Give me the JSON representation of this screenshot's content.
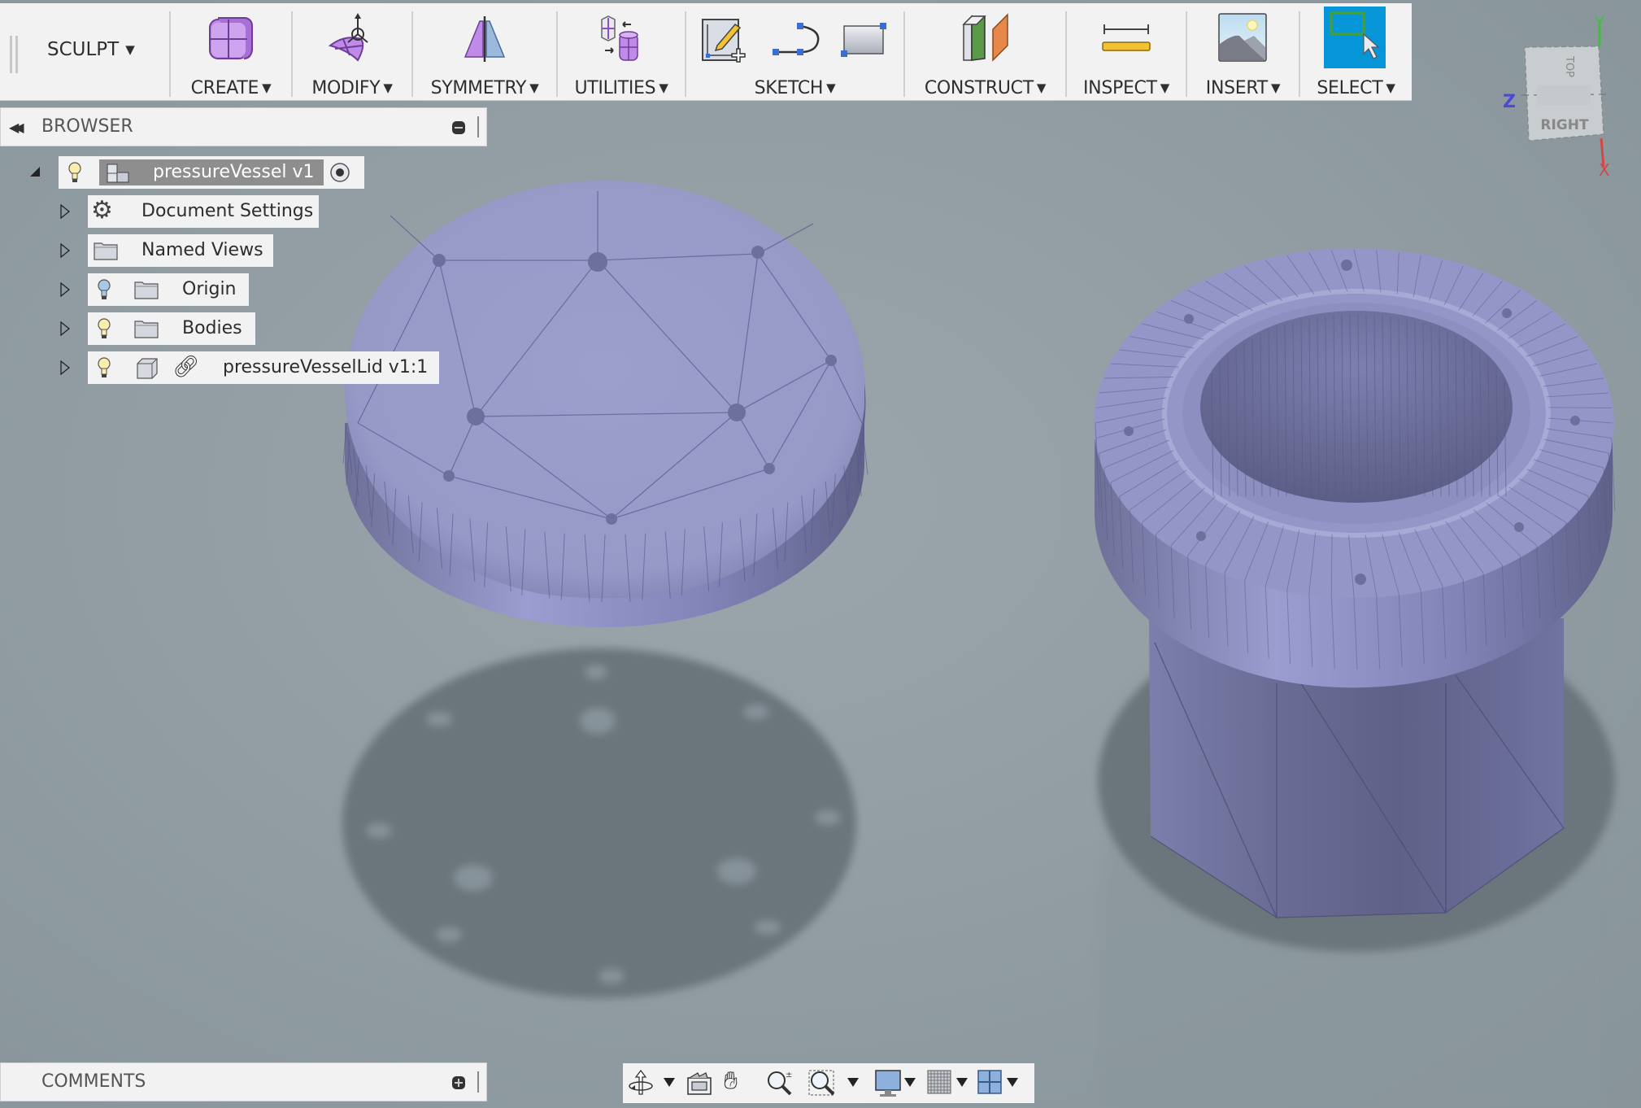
{
  "toolbar": {
    "workspace": "SCULPT",
    "groups": [
      {
        "id": "create",
        "label": "CREATE",
        "icon": "create-box-icon"
      },
      {
        "id": "modify",
        "label": "MODIFY",
        "icon": "modify-surface-icon"
      },
      {
        "id": "symmetry",
        "label": "SYMMETRY",
        "icon": "symmetry-icon"
      },
      {
        "id": "utilities",
        "label": "UTILITIES",
        "icon": "utilities-convert-icon"
      },
      {
        "id": "sketch",
        "label": "SKETCH",
        "icons": [
          "create-sketch-icon",
          "arc-icon",
          "rectangle-icon"
        ]
      },
      {
        "id": "construct",
        "label": "CONSTRUCT",
        "icon": "construct-plane-icon"
      },
      {
        "id": "inspect",
        "label": "INSPECT",
        "icon": "measure-icon"
      },
      {
        "id": "insert",
        "label": "INSERT",
        "icon": "insert-image-icon"
      },
      {
        "id": "select",
        "label": "SELECT",
        "icon": "select-window-icon",
        "active": true
      }
    ],
    "caret": "▼"
  },
  "browser": {
    "title": "BROWSER",
    "collapse_icon": "◀◀",
    "tree": [
      {
        "label": "pressureVessel v1",
        "expanded": true,
        "icons": [
          "lightbulb-icon",
          "component-icon"
        ],
        "active": true,
        "radio": true
      },
      {
        "label": "Document Settings",
        "icons": [
          "gear-icon"
        ]
      },
      {
        "label": "Named Views",
        "icons": [
          "folder-icon"
        ]
      },
      {
        "label": "Origin",
        "icons": [
          "lightbulb-off-icon",
          "folder-icon"
        ]
      },
      {
        "label": "Bodies",
        "icons": [
          "lightbulb-icon",
          "folder-icon"
        ]
      },
      {
        "label": "pressureVesselLid v1:1",
        "icons": [
          "lightbulb-icon",
          "body-icon",
          "link-icon"
        ]
      }
    ]
  },
  "comments": {
    "title": "COMMENTS"
  },
  "viewcube": {
    "face_front": "RIGHT",
    "face_top": "TOP",
    "axes": {
      "x": "X",
      "y": "Y",
      "z": "Z"
    }
  },
  "navbar": {
    "items": [
      "orbit-icon",
      "look-at-icon",
      "pan-icon",
      "zoom-icon",
      "zoom-window-icon",
      "display-settings-icon",
      "grid-icon",
      "viewports-icon"
    ]
  },
  "colors": {
    "accent": "#0696d7",
    "model": "#9a9cc9",
    "background": "#929ea4",
    "panel": "#f2f2f2"
  }
}
